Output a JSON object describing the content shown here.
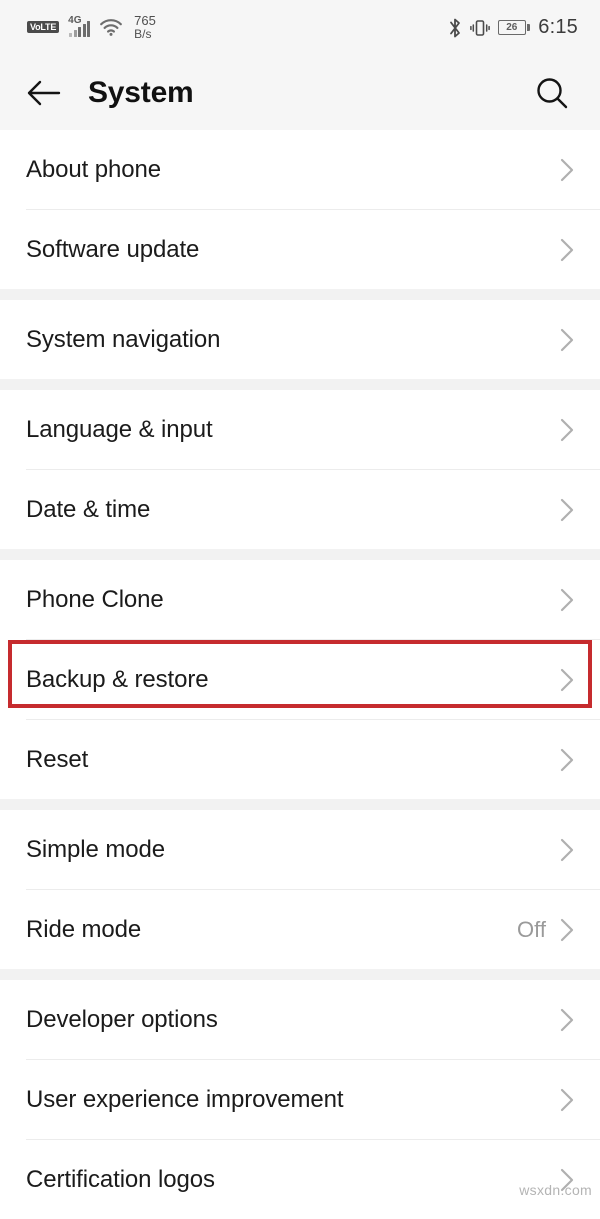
{
  "status_bar": {
    "volte_label": "VoLTE",
    "network_gen": "4G",
    "network_speed_value": "765",
    "network_speed_unit": "B/s",
    "bluetooth_icon": "bluetooth-icon",
    "vibrate_icon": "vibrate-icon",
    "battery_percent": "26",
    "time": "6:15"
  },
  "header": {
    "back_icon": "back-arrow-icon",
    "title": "System",
    "search_icon": "search-icon"
  },
  "groups": [
    {
      "items": [
        {
          "label": "About phone",
          "value": ""
        },
        {
          "label": "Software update",
          "value": ""
        }
      ]
    },
    {
      "items": [
        {
          "label": "System navigation",
          "value": ""
        }
      ]
    },
    {
      "items": [
        {
          "label": "Language & input",
          "value": ""
        },
        {
          "label": "Date & time",
          "value": ""
        }
      ]
    },
    {
      "items": [
        {
          "label": "Phone Clone",
          "value": ""
        },
        {
          "label": "Backup & restore",
          "value": ""
        },
        {
          "label": "Reset",
          "value": ""
        }
      ]
    },
    {
      "items": [
        {
          "label": "Simple mode",
          "value": ""
        },
        {
          "label": "Ride mode",
          "value": "Off"
        }
      ]
    },
    {
      "items": [
        {
          "label": "Developer options",
          "value": ""
        },
        {
          "label": "User experience improvement",
          "value": ""
        },
        {
          "label": "Certification logos",
          "value": ""
        }
      ]
    }
  ],
  "annotation": {
    "highlight_color": "#c62b2e",
    "highlighted_item": "Backup & restore"
  },
  "watermark": {
    "text": "wsxdn.com"
  }
}
